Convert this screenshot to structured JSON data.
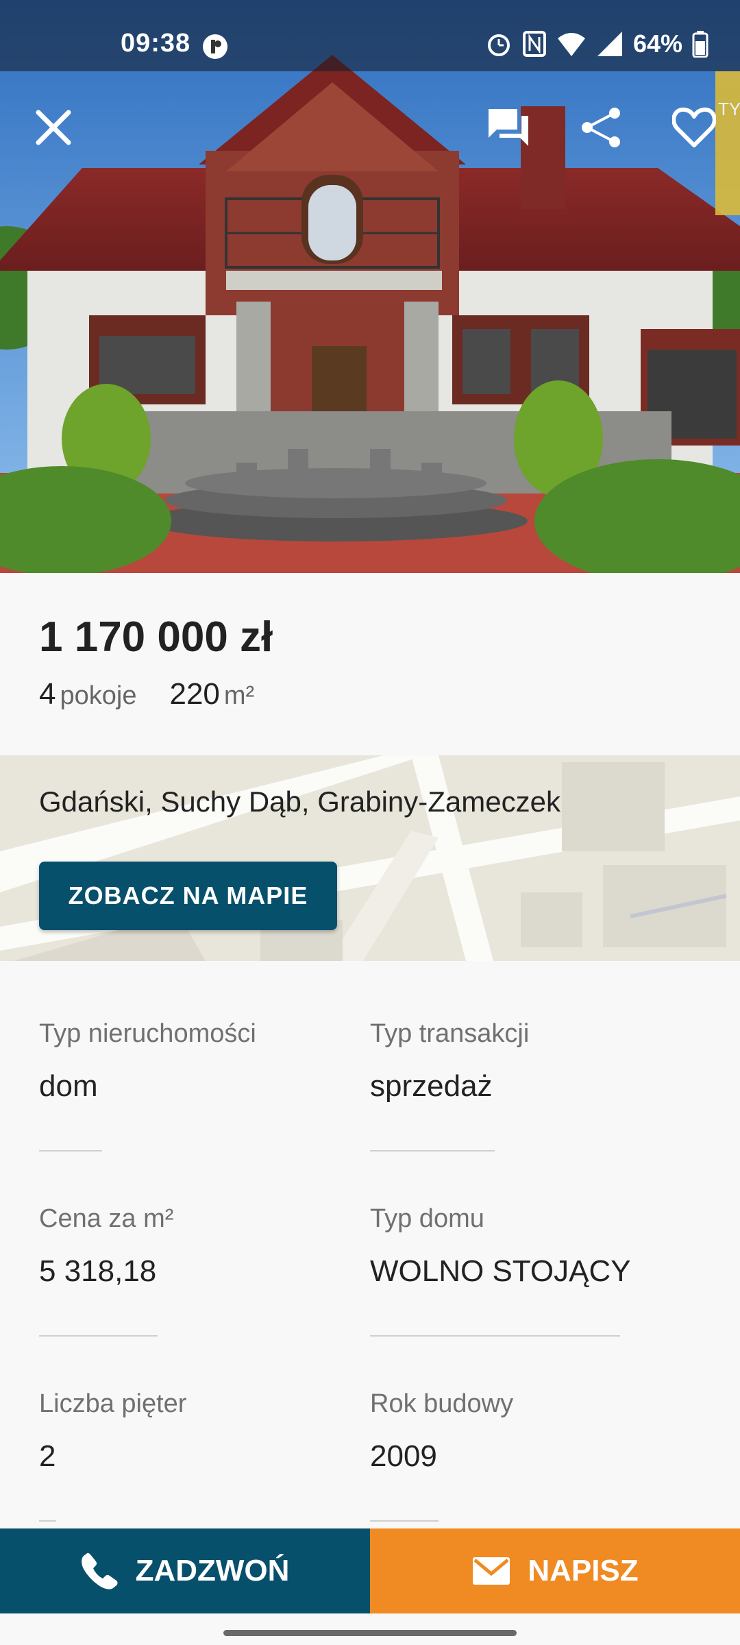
{
  "status_bar": {
    "time": "09:38",
    "battery": "64%",
    "icons": [
      "alarm-icon",
      "nfc-icon",
      "wifi-icon",
      "signal-icon",
      "battery-icon"
    ]
  },
  "toolbar": {
    "icons": [
      "close-icon",
      "chat-icon",
      "share-icon",
      "heart-icon"
    ],
    "badge_text": "TY"
  },
  "listing": {
    "price": "1 170 000 zł",
    "rooms_value": "4",
    "rooms_unit": "pokoje",
    "area_value": "220",
    "area_unit": "m²"
  },
  "location": {
    "address": "Gdański, Suchy Dąb, Grabiny-Zameczek",
    "map_button": "ZOBACZ NA MAPIE"
  },
  "details": [
    {
      "label": "Typ nieruchomości",
      "value": "dom"
    },
    {
      "label": "Typ transakcji",
      "value": "sprzedaż"
    },
    {
      "label": "Cena za m²",
      "value": "5 318,18"
    },
    {
      "label": "Typ domu",
      "value": "WOLNO STOJĄCY"
    },
    {
      "label": "Liczba pięter",
      "value": "2"
    },
    {
      "label": "Rok budowy",
      "value": "2009"
    }
  ],
  "actions": {
    "call": "ZADZWOŃ",
    "write": "NAPISZ"
  },
  "colors": {
    "primary": "#07506c",
    "accent": "#f08a22",
    "background": "#f8f8f8"
  }
}
